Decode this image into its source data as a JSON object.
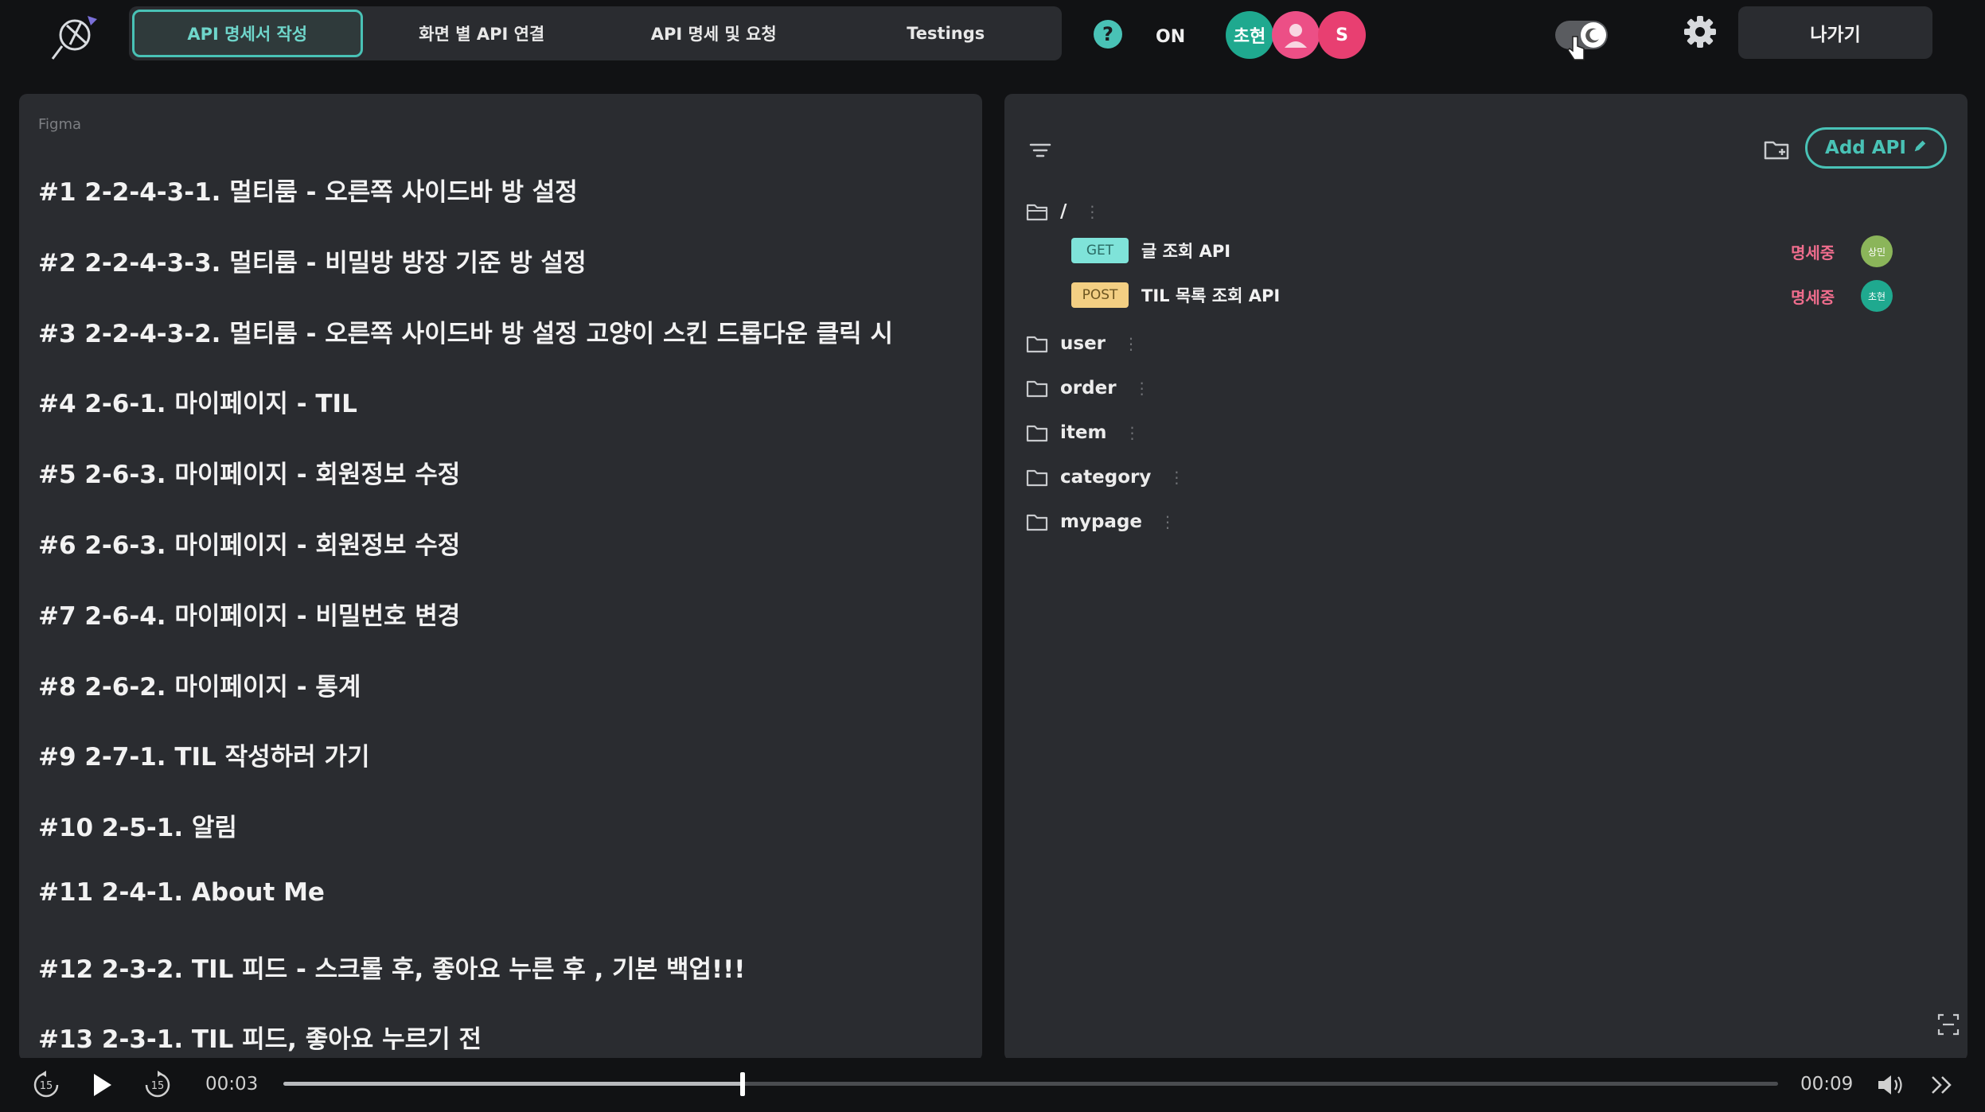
{
  "header": {
    "tabs": [
      {
        "label": "API 명세서 작성",
        "active": true
      },
      {
        "label": "화면 별 API 연결",
        "active": false
      },
      {
        "label": "API 명세 및 요청",
        "active": false
      },
      {
        "label": "Testings",
        "active": false
      }
    ],
    "help_label": "?",
    "online_label": "ON",
    "avatars": [
      {
        "label": "초현",
        "color": "#1fa98f"
      },
      {
        "label": "",
        "color": "#ec4f86"
      },
      {
        "label": "S",
        "color": "#e83f71"
      }
    ],
    "exit_label": "나가기"
  },
  "left": {
    "source_label": "Figma",
    "frames": [
      "#1 2-2-4-3-1. 멀티룸 - 오른쪽 사이드바 방 설정",
      "#2 2-2-4-3-3. 멀티룸 - 비밀방 방장 기준 방 설정",
      "#3 2-2-4-3-2. 멀티룸 - 오른쪽 사이드바 방 설정 고양이 스킨 드롭다운 클릭 시",
      "#4 2-6-1. 마이페이지 - TIL",
      "#5 2-6-3. 마이페이지 - 회원정보 수정",
      "#6 2-6-3. 마이페이지 - 회원정보 수정",
      "#7 2-6-4. 마이페이지 - 비밀번호 변경",
      "#8 2-6-2. 마이페이지 - 통계",
      "#9 2-7-1. TIL 작성하러 가기",
      "#10 2-5-1. 알림",
      "#11 2-4-1. About Me",
      "#12 2-3-2. TIL 피드 - 스크롤 후, 좋아요 누른 후 , 기본 백업!!!",
      "#13 2-3-1. TIL 피드, 좋아요 누르기 전"
    ]
  },
  "right": {
    "add_api_label": "Add API",
    "root_folder": "/",
    "apis": [
      {
        "method": "GET",
        "name": "글 조회 API",
        "status": "명세중",
        "avatar_label": "상민",
        "avatar_color": "#8bb55a"
      },
      {
        "method": "POST",
        "name": "TIL 목록 조회 API",
        "status": "명세중",
        "avatar_label": "초현",
        "avatar_color": "#1fa98f"
      }
    ],
    "folders": [
      "user",
      "order",
      "item",
      "category",
      "mypage"
    ]
  },
  "player": {
    "current_time": "00:03",
    "total_time": "00:09",
    "progress": 0.33
  },
  "colors": {
    "accent": "#49c2b6",
    "status_pink": "#ef6d8d",
    "panel_bg": "#2a2c30",
    "page_bg": "#111214"
  }
}
